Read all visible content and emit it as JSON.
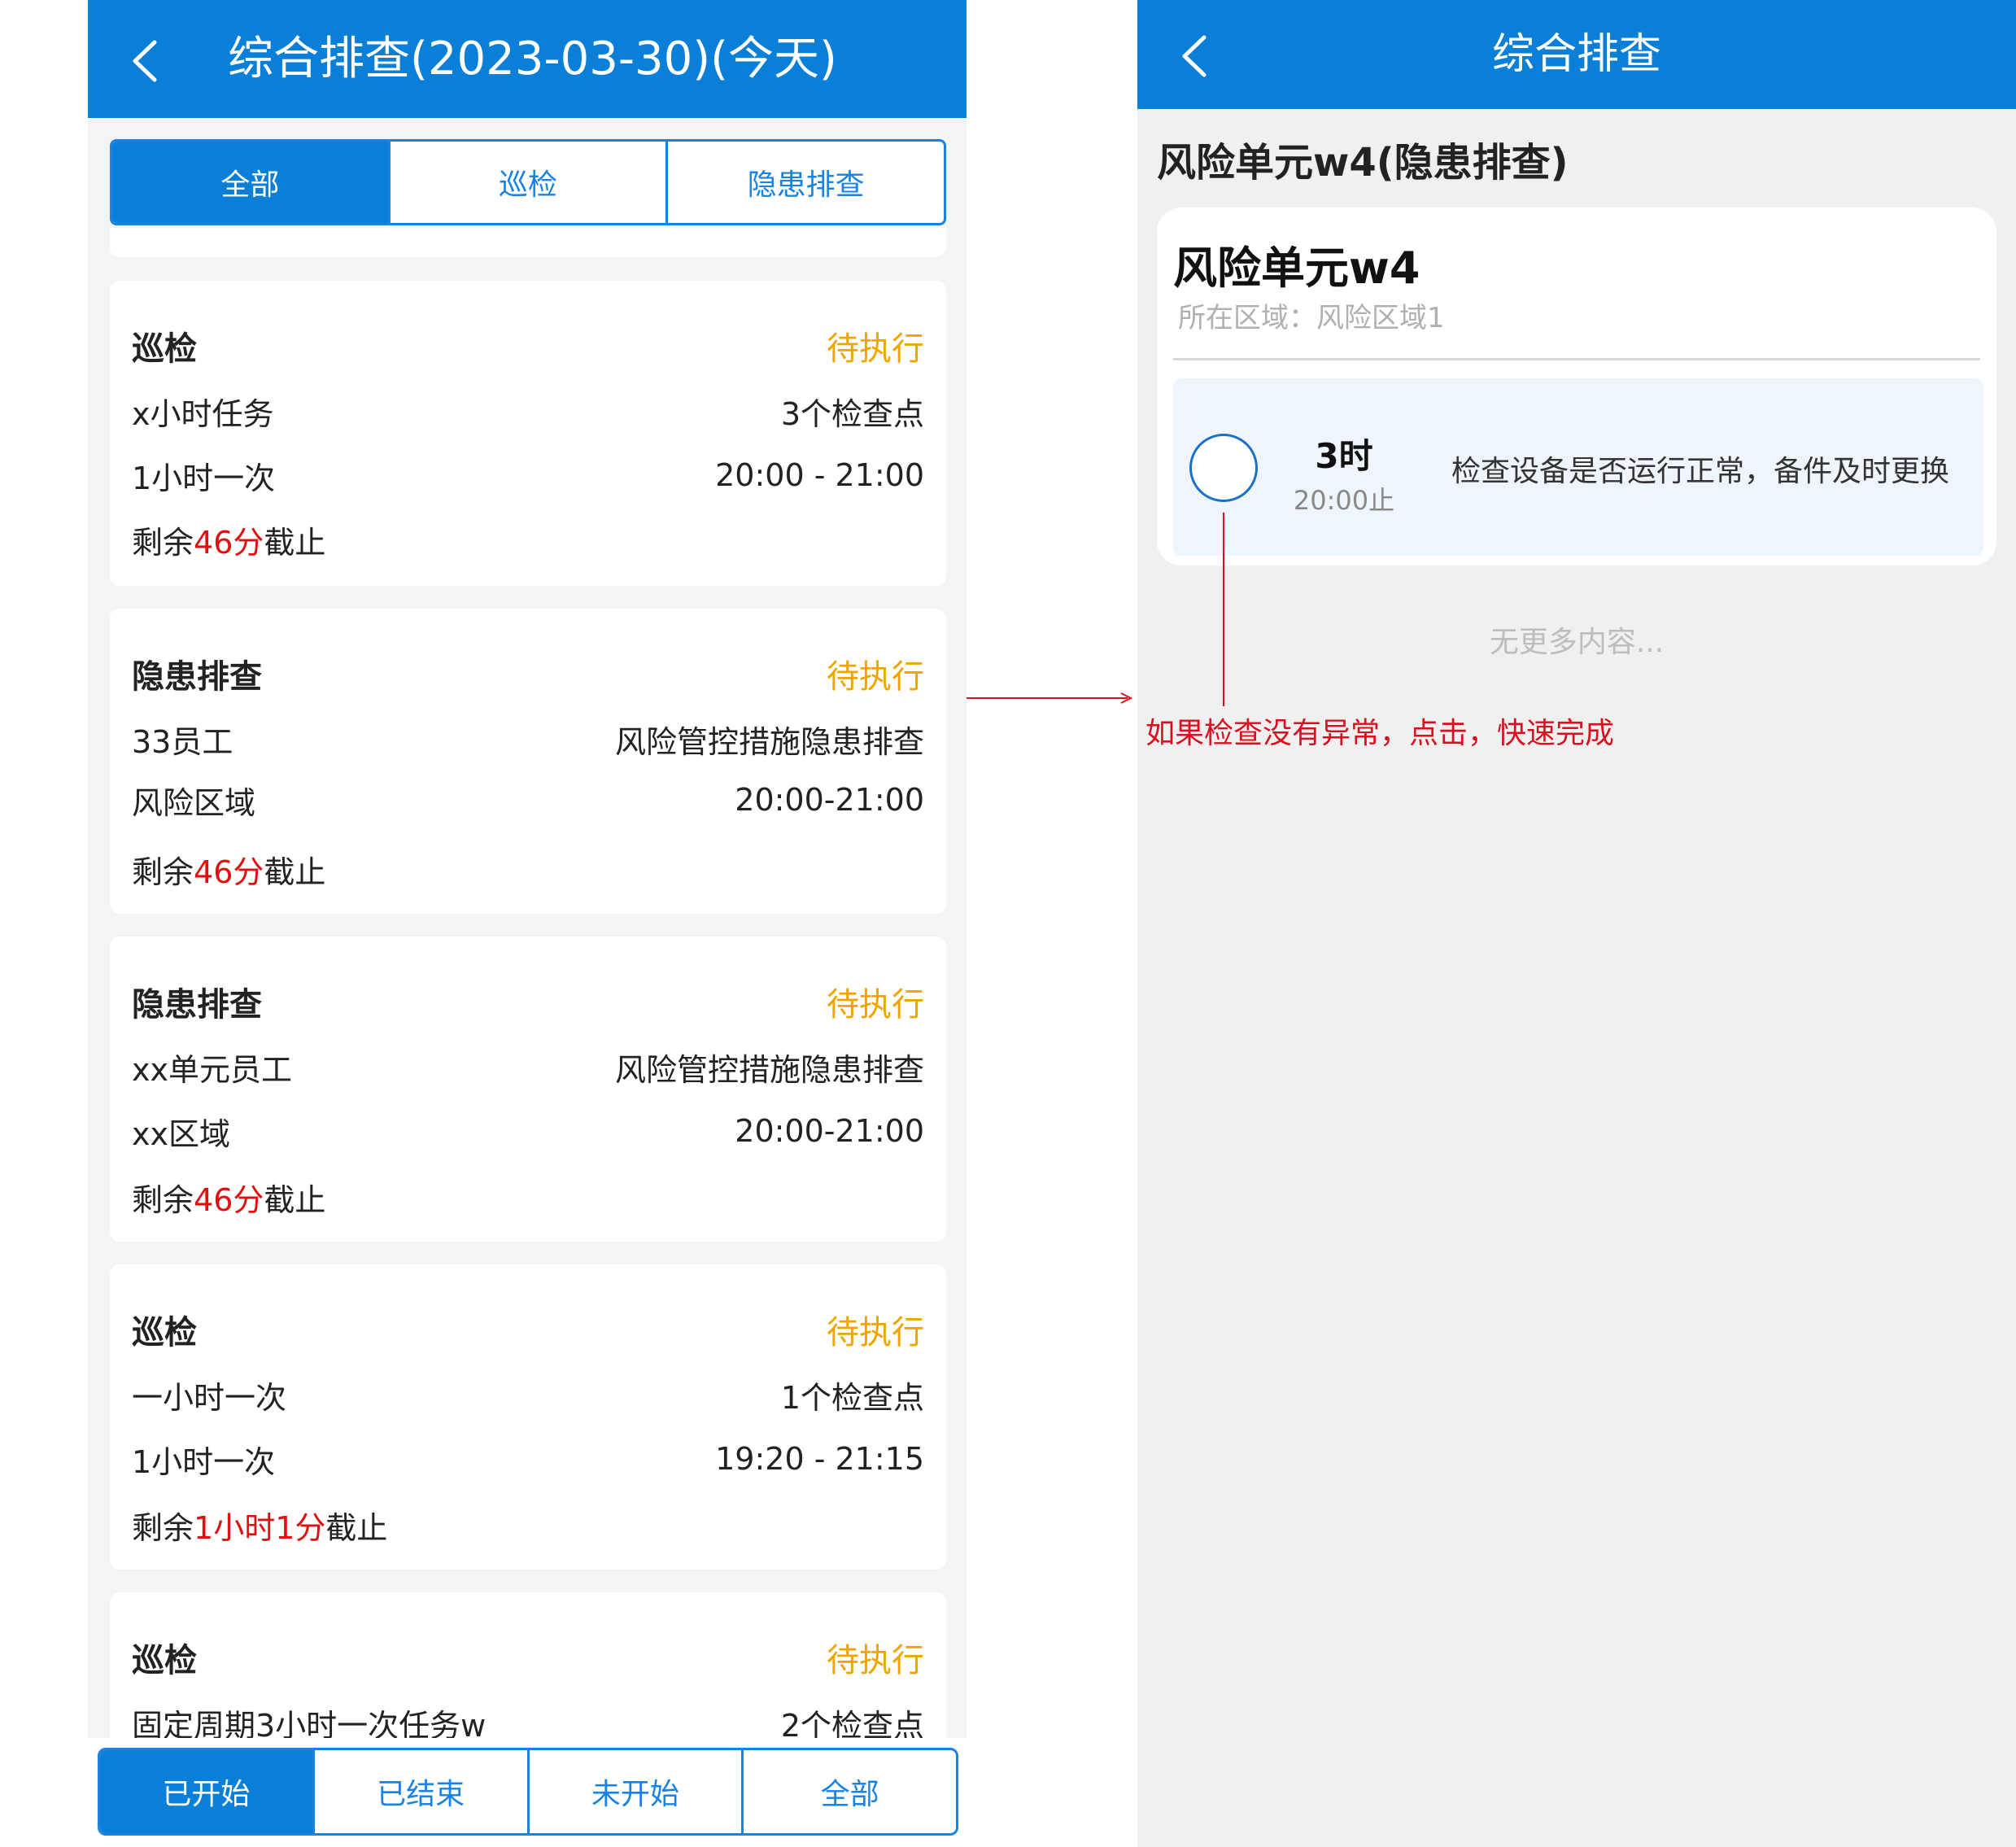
{
  "left": {
    "header": {
      "title": "综合排查(2023-03-30)(今天)"
    },
    "top_tabs": [
      "全部",
      "巡检",
      "隐患排查"
    ],
    "cards": [
      {
        "type": "巡检",
        "status": "待执行",
        "r1_left": "x小时任务",
        "r1_right": "3个检查点",
        "r2_left": "1小时一次",
        "r2_right": "20:00 - 21:00",
        "rem_prefix": "剩余",
        "rem_value": "46分",
        "rem_suffix": "截止"
      },
      {
        "type": "隐患排查",
        "status": "待执行",
        "r1_left": "33员工",
        "r1_right": "风险管控措施隐患排查",
        "r2_left": "风险区域",
        "r2_right": "20:00-21:00",
        "rem_prefix": "剩余",
        "rem_value": "46分",
        "rem_suffix": "截止"
      },
      {
        "type": "隐患排查",
        "status": "待执行",
        "r1_left": "xx单元员工",
        "r1_right": "风险管控措施隐患排查",
        "r2_left": "xx区域",
        "r2_right": "20:00-21:00",
        "rem_prefix": "剩余",
        "rem_value": "46分",
        "rem_suffix": "截止"
      },
      {
        "type": "巡检",
        "status": "待执行",
        "r1_left": "一小时一次",
        "r1_right": "1个检查点",
        "r2_left": "1小时一次",
        "r2_right": "19:20 - 21:15",
        "rem_prefix": "剩余",
        "rem_value": "1小时1分",
        "rem_suffix": "截止"
      },
      {
        "type": "巡检",
        "status": "待执行",
        "r1_left": "固定周期3小时一次任务w",
        "r1_right": "2个检查点"
      }
    ],
    "bottom_tabs": [
      "已开始",
      "已结束",
      "未开始",
      "全部"
    ]
  },
  "right": {
    "header": {
      "title": "综合排查"
    },
    "unit_heading": "风险单元w4(隐患排查)",
    "unit_card": {
      "name": "风险单元w4",
      "area": "所在区域：风险区域1",
      "task": {
        "hours": "3时",
        "until": "20:00止",
        "desc": "检查设备是否运行正常，备件及时更换"
      }
    },
    "no_more": "无更多内容..."
  },
  "annotation": {
    "text": "如果检查没有异常，点击，快速完成"
  },
  "colors": {
    "brand": "#0a7fd8",
    "pending": "#f0a400",
    "remaining": "#e01010",
    "annotation": "#d81020"
  }
}
